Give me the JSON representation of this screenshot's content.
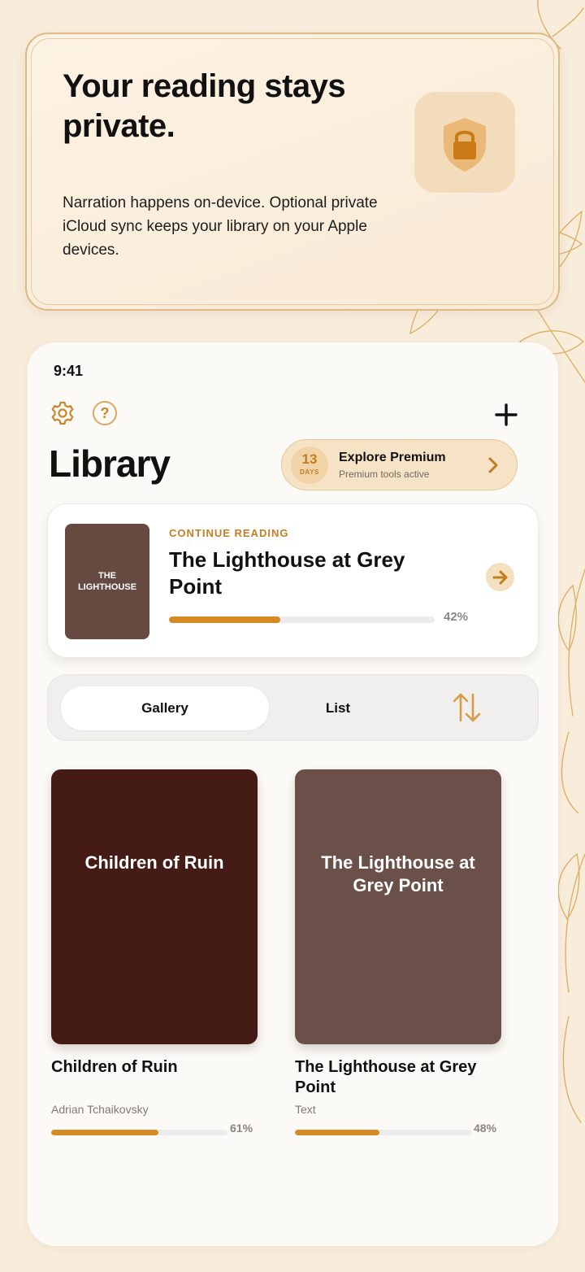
{
  "promo": {
    "title": "Your reading stays private.",
    "description": "Narration happens on-device. Optional private iCloud sync keeps your library on your Apple devices.",
    "icon": "lock-shield-icon"
  },
  "status_bar": {
    "time": "9:41"
  },
  "header": {
    "settings_icon": "gear-icon",
    "help_icon": "question-circle-icon",
    "help_glyph": "?",
    "add_icon": "plus-icon",
    "title": "Library"
  },
  "premium": {
    "days": "13",
    "days_label": "DAYS",
    "title": "Explore Premium",
    "subtitle": "Premium tools active",
    "icon": "chevron-right-icon"
  },
  "continue_reading": {
    "label": "CONTINUE READING",
    "cover_text": "THE LIGHTHOUSE",
    "title": "The Lighthouse at Grey Point",
    "progress": 0.42,
    "progress_label": "42%",
    "go_icon": "arrow-right-icon"
  },
  "view_toggle": {
    "options": [
      "Gallery",
      "List"
    ],
    "selected": "Gallery",
    "sort_icon": "sort-up-down-icon"
  },
  "books": [
    {
      "cover_title": "Children of Ruin",
      "title": "Children of Ruin",
      "author": "Adrian Tchaikovsky",
      "progress": 0.61,
      "progress_label": "61%",
      "cover_color": "#451b16"
    },
    {
      "cover_title": "The Lighthouse at Grey Point",
      "title": "The Lighthouse at Grey Point",
      "author": "Text",
      "progress": 0.48,
      "progress_label": "48%",
      "cover_color": "#6a5048"
    }
  ],
  "colors": {
    "accent": "#d68a24",
    "background": "#f8ecdb",
    "panel": "#fcfaf6"
  }
}
